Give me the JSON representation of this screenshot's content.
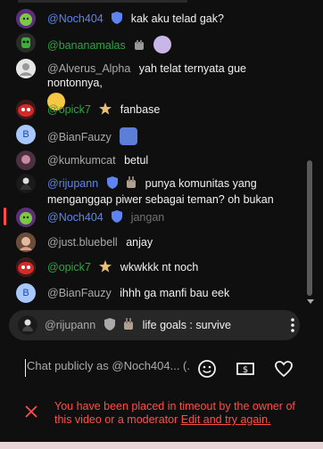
{
  "messages": [
    {
      "author": "@Noch404",
      "text": "kak aku telad gak?",
      "author_color": "blue",
      "badge": "moderator",
      "avatar": "green"
    },
    {
      "author": "@bananamalas",
      "text": "",
      "author_color": "green",
      "badge": "member",
      "avatar": "green-lime"
    },
    {
      "author": "@Alverus_Alpha",
      "text": "yah telat ternyata gue nontonnya,",
      "author_color": "green",
      "badge": "",
      "avatar": "white"
    },
    {
      "author": "@opick7",
      "text": "fanbase",
      "author_color": "green",
      "badge": "member",
      "avatar": "red"
    },
    {
      "author": "@BianFauzy",
      "text": "",
      "author_color": "gray",
      "badge": "",
      "avatar": "letter-b"
    },
    {
      "author": "@kumkumcat",
      "text": "betul",
      "author_color": "gray",
      "badge": "",
      "avatar": "dark"
    },
    {
      "author": "@rijupann",
      "text": "punya komunitas yang menganggap piwer sebagai teman? oh bukan",
      "author_color": "blue",
      "badge": "verified",
      "avatar": "black"
    },
    {
      "author": "@Noch404",
      "text": "jangan",
      "author_color": "blue",
      "badge": "moderator",
      "avatar": "green"
    },
    {
      "author": "@just.bluebell",
      "text": "anjay",
      "author_color": "gray",
      "badge": "",
      "avatar": "photo"
    },
    {
      "author": "@opick7",
      "text": "wkwkkk nt noch",
      "author_color": "green",
      "badge": "member",
      "avatar": "red"
    },
    {
      "author": "@BianFauzy",
      "text": "ihhh ga manfi bau eek",
      "author_color": "gray",
      "badge": "",
      "avatar": "letter-b"
    }
  ],
  "pinned": {
    "author": "@rijupann",
    "text": "life goals : survive"
  },
  "input": {
    "placeholder": "Chat publicly as @Noch404... (..."
  },
  "timeout": {
    "message": "You have been placed in timeout by the owner of this video or a moderator",
    "link": "Edit and try again."
  },
  "avatar_letter": "B",
  "icons": {
    "emoji": "smiley-icon",
    "super_chat": "dollar-bill-icon",
    "like": "heart-icon",
    "close": "close-x-icon",
    "menu": "vertical-dots-icon"
  },
  "colors": {
    "background": "#0f0f0f",
    "moderator": "#5e84f1",
    "member": "#2ba640",
    "error": "#ff4e45"
  }
}
